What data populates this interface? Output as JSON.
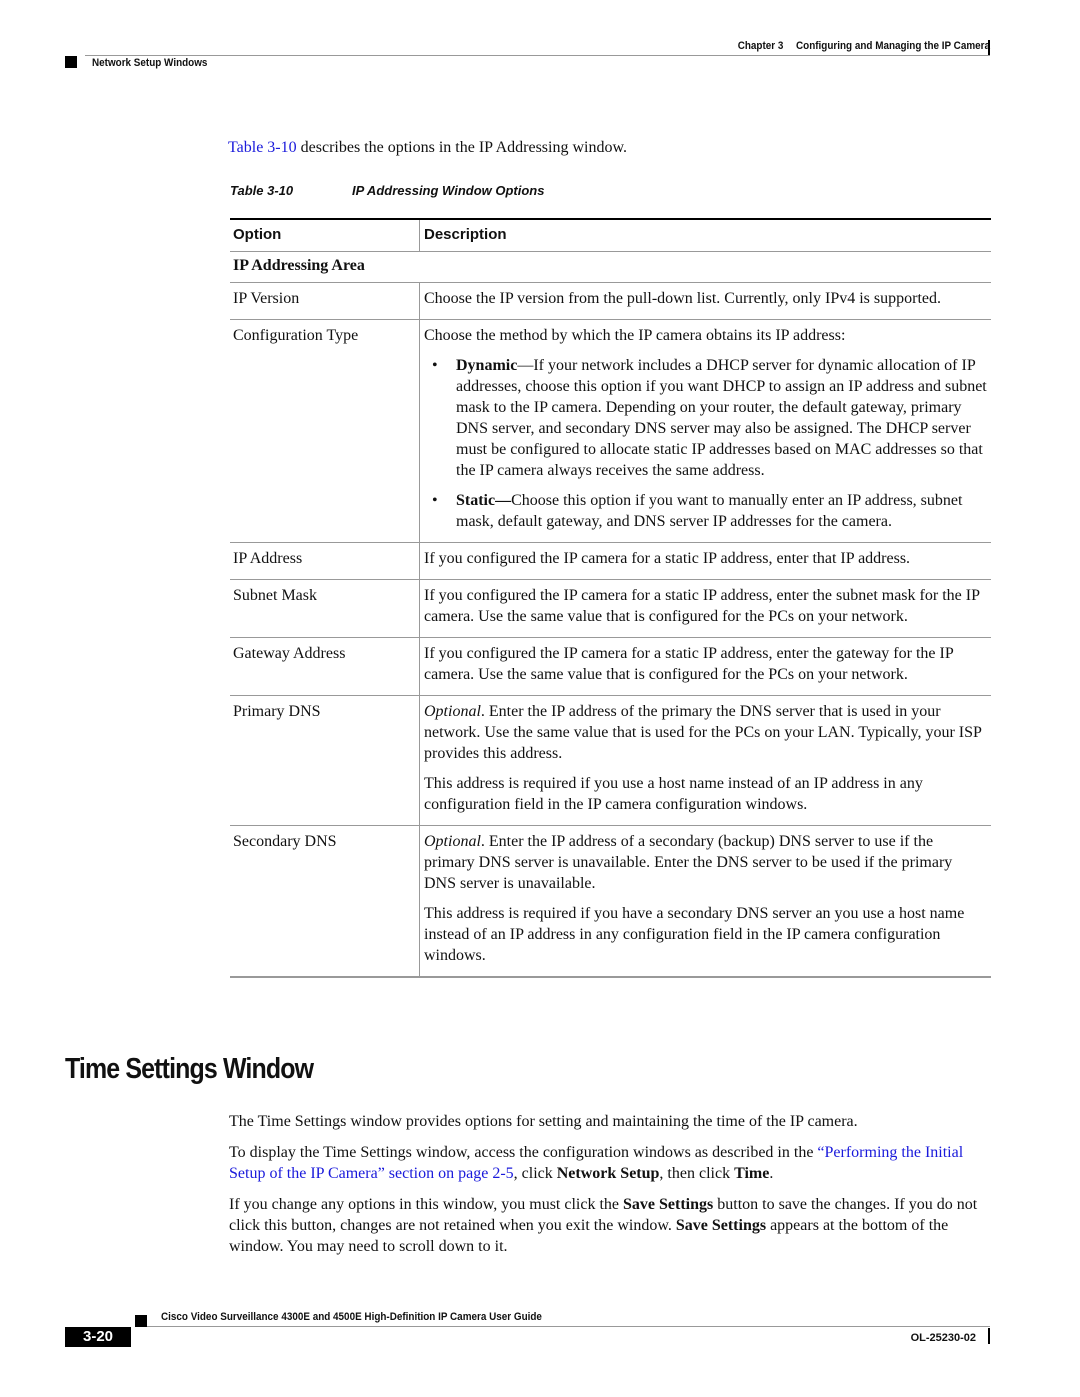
{
  "header": {
    "chapter": "Chapter 3",
    "chapter_title": "Configuring and Managing the IP Camera",
    "section": "Network Setup Windows"
  },
  "intro": {
    "link_text": "Table 3-10",
    "rest": " describes the options in the IP Addressing window."
  },
  "table": {
    "caption_number": "Table 3-10",
    "caption_title": "IP Addressing Window Options",
    "headers": {
      "option": "Option",
      "description": "Description"
    },
    "area_title": "IP Addressing Area",
    "rows": [
      {
        "option": "IP Version",
        "description": "Choose the IP version from the pull-down list. Currently, only IPv4 is supported."
      },
      {
        "option": "Configuration Type",
        "description": "Choose the method by which the IP camera obtains its IP address:",
        "bullets": [
          {
            "bold": "Dynamic",
            "text": "—If your network includes a DHCP server for dynamic allocation of IP addresses, choose this option if you want DHCP to assign an IP address and subnet mask to the IP camera. Depending on your router, the default gateway, primary DNS server, and secondary DNS server may also be assigned. The DHCP server must be configured to allocate static IP addresses based on MAC addresses so that the IP camera always receives the same address."
          },
          {
            "bold": "Static—",
            "text": "Choose this option if you want to manually enter an IP address, subnet mask, default gateway, and DNS server IP addresses for the camera."
          }
        ]
      },
      {
        "option": "IP Address",
        "description": "If you configured the IP camera for a static IP address, enter that IP address."
      },
      {
        "option": "Subnet Mask",
        "description": "If you configured the IP camera for a static IP address, enter the subnet mask for the IP camera. Use the same value that is configured for the PCs on your network."
      },
      {
        "option": "Gateway Address",
        "description": "If you configured the IP camera for a static IP address, enter the gateway for the IP camera. Use the same value that is configured for the PCs on your network."
      },
      {
        "option": "Primary DNS",
        "italic_lead": "Optional",
        "description": ". Enter the IP address of the primary the DNS server that is used in your network. Use the same value that is used for the PCs on your LAN. Typically, your ISP provides this address.",
        "extra": "This address is required if you use a host name instead of an IP address in any configuration field in the IP camera configuration windows."
      },
      {
        "option": "Secondary DNS",
        "italic_lead": "Optional",
        "description": ". Enter the IP address of a secondary (backup) DNS server to use if the primary DNS server is unavailable. Enter the DNS server to be used if the primary DNS server is unavailable.",
        "extra": "This address is required if you have a secondary DNS server an you use a host name instead of an IP address in any configuration field in the IP camera configuration windows."
      }
    ]
  },
  "section": {
    "title": "Time Settings Window",
    "p1": "The Time Settings window provides options for setting and maintaining the time of the IP camera.",
    "p2_a": "To display the Time Settings window, access the configuration windows as described in the ",
    "p2_link": "“Performing the Initial Setup of the IP Camera” section on page 2-5",
    "p2_b": ", click ",
    "p2_bold1": "Network Setup",
    "p2_c": ", then click ",
    "p2_bold2": "Time",
    "p2_d": ".",
    "p3_a": "If you change any options in this window, you must click the ",
    "p3_bold1": "Save Settings",
    "p3_b": " button to save the changes. If you do not click this button, changes are not retained when you exit the window. ",
    "p3_bold2": "Save Settings",
    "p3_c": " appears at the bottom of the window. You may need to scroll down to it."
  },
  "footer": {
    "guide_title": "Cisco Video Surveillance 4300E and 4500E High-Definition IP Camera User Guide",
    "page_number": "3-20",
    "doc_number": "OL-25230-02"
  },
  "colors": {
    "link": "#1a1adb",
    "rule": "#999999"
  }
}
